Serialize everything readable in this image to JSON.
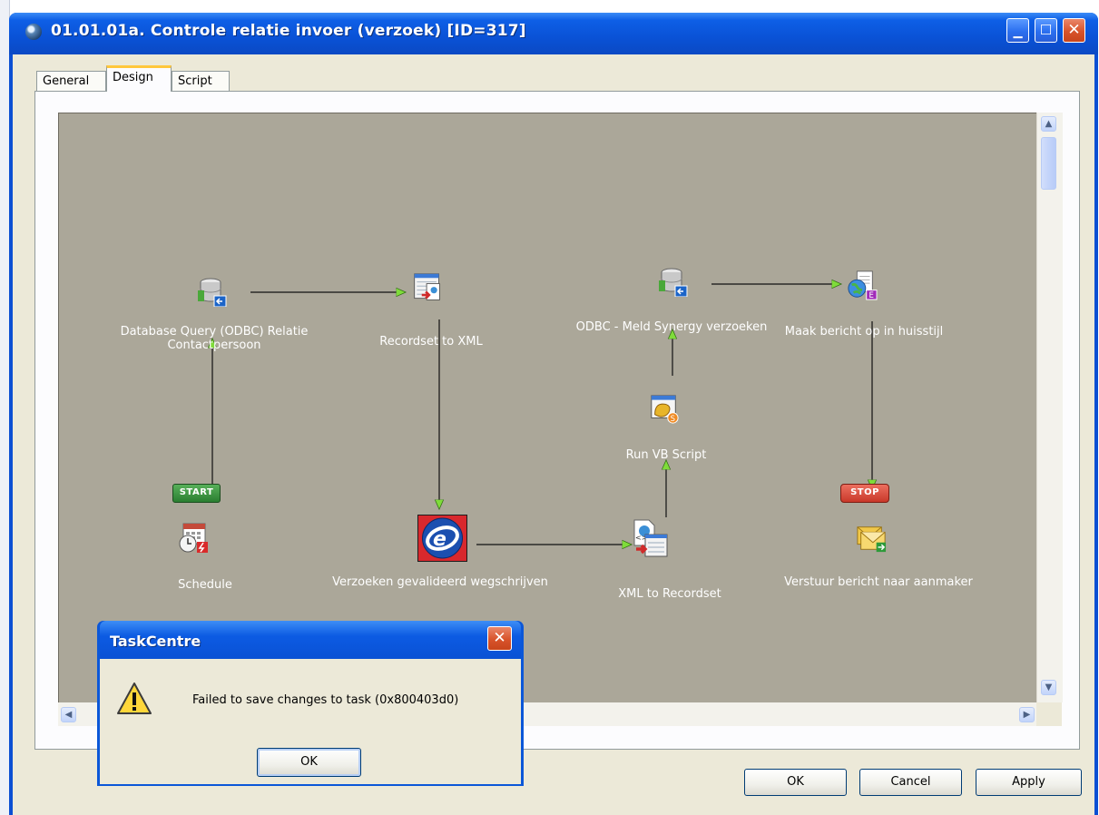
{
  "window": {
    "title": "01.01.01a. Controle relatie invoer (verzoek) [ID=317]",
    "caption_buttons": [
      "minimize",
      "maximize",
      "close"
    ]
  },
  "tabs": [
    {
      "label": "General",
      "selected": false
    },
    {
      "label": "Design",
      "selected": true
    },
    {
      "label": "Script",
      "selected": false
    }
  ],
  "flow": {
    "nodes": [
      {
        "id": "db-query",
        "label_line1": "Database Query (ODBC) Relatie",
        "label_line2": "Contactpersoon",
        "icon": "database-query-icon"
      },
      {
        "id": "rs-to-xml",
        "label": "Recordset to XML",
        "icon": "recordset-to-xml-icon"
      },
      {
        "id": "odbc-meld",
        "label": "ODBC - Meld Synergy verzoeken",
        "icon": "database-query-icon"
      },
      {
        "id": "maak-bericht",
        "label": "Maak bericht op in huisstijl",
        "icon": "html-document-icon"
      },
      {
        "id": "run-vb",
        "label": "Run VB Script",
        "icon": "script-icon"
      },
      {
        "id": "schedule",
        "label": "Schedule",
        "icon": "schedule-icon",
        "badge": "START"
      },
      {
        "id": "verzoeken",
        "label": "Verzoeken gevalideerd wegschrijven",
        "icon": "connector-e-icon"
      },
      {
        "id": "xml-to-rs",
        "label": "XML to Recordset",
        "icon": "xml-to-recordset-icon"
      },
      {
        "id": "verstuur",
        "label": "Verstuur bericht naar aanmaker",
        "icon": "send-mail-icon",
        "badge": "STOP"
      }
    ]
  },
  "buttons": {
    "ok": "OK",
    "cancel": "Cancel",
    "apply": "Apply"
  },
  "message_box": {
    "title": "TaskCentre",
    "message": "Failed to save changes to task (0x800403d0)",
    "ok": "OK",
    "icon": "warning-icon"
  },
  "colors": {
    "canvas": "#aba799",
    "titlebar": "#0a52d6",
    "start_badge": "#2e8b3a",
    "stop_badge": "#d9412f"
  }
}
